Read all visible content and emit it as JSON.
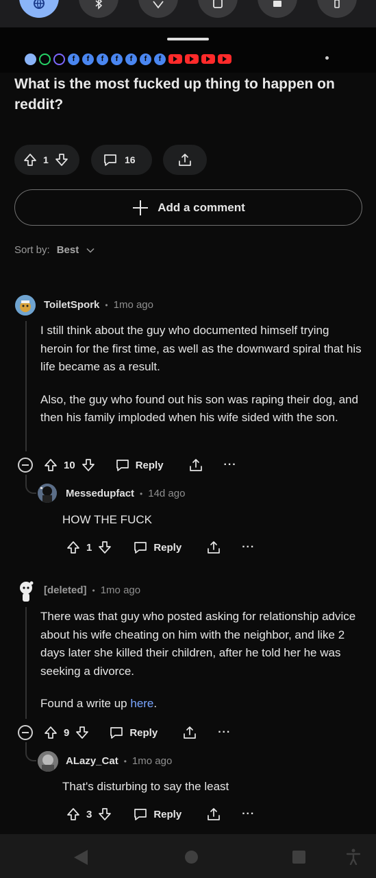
{
  "status_shade": {
    "tiles": [
      {
        "icon": "globe-icon",
        "active": true
      },
      {
        "icon": "bluetooth-icon",
        "active": false
      },
      {
        "icon": "wifi-icon",
        "active": false
      },
      {
        "icon": "nfc-icon",
        "active": false
      },
      {
        "icon": "cast-icon",
        "active": false
      },
      {
        "icon": "battery-icon",
        "active": false
      }
    ],
    "notification_icons": [
      "messages-icon",
      "whatsapp-icon",
      "viber-icon",
      "facebook-icon",
      "facebook-icon",
      "facebook-icon",
      "facebook-icon",
      "facebook-icon",
      "facebook-icon",
      "facebook-icon",
      "youtube-icon",
      "youtube-icon",
      "youtube-icon",
      "youtube-icon"
    ]
  },
  "post": {
    "title": "What is the most fucked up thing to happen on reddit?",
    "votes": "1",
    "comments": "16"
  },
  "composer": {
    "add_comment_label": "Add a comment"
  },
  "sort": {
    "label": "Sort by:",
    "value": "Best"
  },
  "comments": [
    {
      "author": "ToiletSpork",
      "age": "1mo ago",
      "paragraphs": [
        "I still think about the guy who documented himself trying heroin for the first time, as well as the downward spiral that his life became as a result.",
        "Also, the guy who found out his son was raping their dog, and then his family imploded when his wife sided with the son."
      ],
      "votes": "10",
      "reply_label": "Reply",
      "more_label": "···",
      "replies": [
        {
          "author": "Messedupfact",
          "age": "14d ago",
          "text": "HOW THE FUCK",
          "votes": "1",
          "reply_label": "Reply",
          "more_label": "···"
        }
      ]
    },
    {
      "author": "[deleted]",
      "age": "1mo ago",
      "paragraphs": [
        "There was that guy who posted asking for relationship advice about his wife cheating on him with the neighbor, and like 2 days later she killed their children, after he told her he was seeking a divorce."
      ],
      "footer_text": "Found a write up ",
      "footer_link": "here",
      "footer_end": ".",
      "votes": "9",
      "reply_label": "Reply",
      "more_label": "···",
      "replies": [
        {
          "author": "ALazy_Cat",
          "age": "1mo ago",
          "text": "That's disturbing to say the least",
          "votes": "3",
          "reply_label": "Reply",
          "more_label": "···"
        }
      ]
    }
  ],
  "colors": {
    "background": "#0b0b0b",
    "link": "#7aa6ff",
    "pill": "#1e1f20"
  }
}
